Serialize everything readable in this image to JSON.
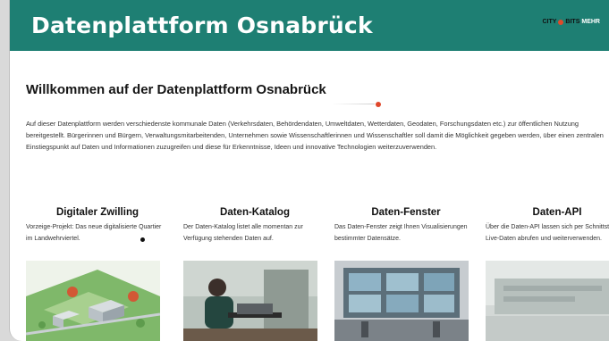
{
  "header": {
    "title": "Datenplattform Osnabrück",
    "logo": {
      "part1": "CITY",
      "part2": "BITS",
      "part3": "MEHR"
    },
    "background_color": "#1e7f73"
  },
  "main": {
    "welcome_heading": "Willkommen auf der Datenplattform Osnabrück",
    "intro_text": "Auf dieser Datenplattform werden verschiedenste kommunale Daten (Verkehrsdaten, Behördendaten, Umweltdaten, Wetterdaten, Geodaten, Forschungsdaten etc.) zur öffentlichen Nutzung bereitgestellt. Bürgerinnen und Bürgern, Verwaltungsmitarbeitenden, Unternehmen sowie Wissenschaftlerinnen und Wissenschaftler soll damit die Möglichkeit gegeben werden, über einen zentralen Einstiegspunkt auf Daten und Informationen zuzugreifen und diese für Erkenntnisse, Ideen und innovative Technologien weiterzuverwenden."
  },
  "cards": [
    {
      "title": "Digitaler Zwilling",
      "description": "Vorzeige-Projekt: Das neue digitalisierte Quartier im Landwehrviertel."
    },
    {
      "title": "Daten-Katalog",
      "description": "Der Daten-Katalog listet alle momentan zur Verfügung stehenden Daten auf."
    },
    {
      "title": "Daten-Fenster",
      "description": "Das Daten-Fenster zeigt Ihnen Visualisierungen bestimmter Datensätze."
    },
    {
      "title": "Daten-API",
      "description": "Über die Daten-API lassen sich per Schnittstelle Live-Daten abrufen und weiterverwenden."
    }
  ],
  "colors": {
    "accent_red": "#e0472b",
    "teal": "#1e7f73"
  }
}
